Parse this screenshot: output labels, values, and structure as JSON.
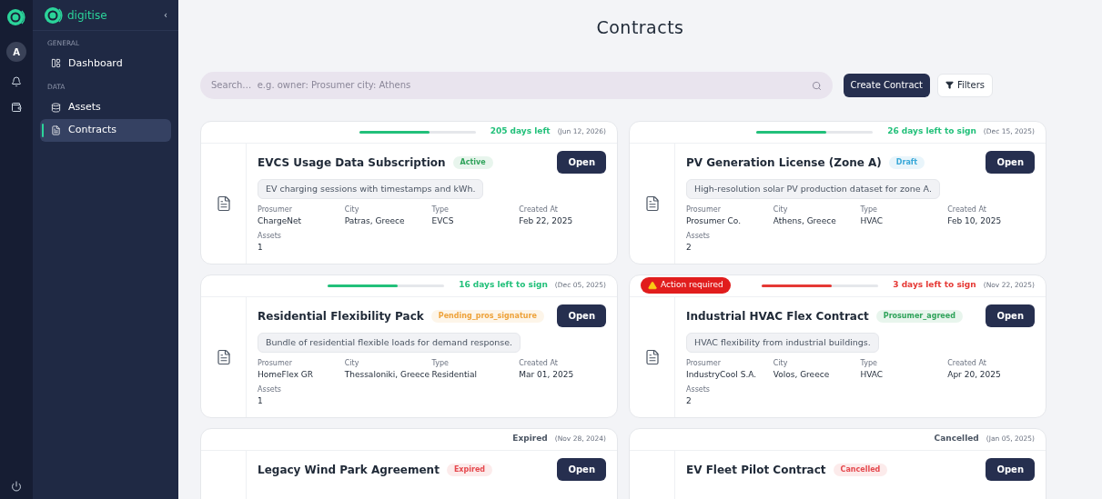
{
  "sidebar": {
    "brand": "digitise",
    "collapse": "‹",
    "avatar": "A",
    "sections": [
      {
        "heading": "GENERAL",
        "items": [
          {
            "label": "Dashboard",
            "selected": false
          }
        ]
      },
      {
        "heading": "DATA",
        "items": [
          {
            "label": "Assets",
            "selected": false
          },
          {
            "label": "Contracts",
            "selected": true
          }
        ]
      }
    ]
  },
  "page": {
    "title": "Contracts"
  },
  "search": {
    "placeholder": "Search…  e.g. owner: Prosumer city: Athens"
  },
  "actions": {
    "create": "Create Contract",
    "filters": "Filters"
  },
  "contracts": [
    {
      "deadline": {
        "label": "205 days left",
        "date": "(Jun 12, 2026)",
        "color": "#22c07a"
      },
      "progress": {
        "level": 0.6
      },
      "title": "EVCS Usage Data Subscription",
      "status": {
        "label": "Active",
        "color": "#2fa35a"
      },
      "description": "EV charging sessions with timestamps and kWh.",
      "fields": [
        {
          "label": "Prosumer",
          "value": "ChargeNet"
        },
        {
          "label": "City",
          "value": "Patras, Greece"
        },
        {
          "label": "Type",
          "value": "EVCS"
        },
        {
          "label": "Created At",
          "value": "Feb 22, 2025"
        },
        {
          "label": "Assets",
          "value": "1"
        }
      ],
      "open": "Open"
    },
    {
      "deadline": {
        "label": "26 days left to sign",
        "date": "(Dec 15, 2025)",
        "color": "#22c07a"
      },
      "progress": {
        "level": 0.6
      },
      "title": "PV Generation License (Zone A)",
      "status": {
        "label": "Draft",
        "color": "#38a8d8"
      },
      "description": "High-resolution solar PV production dataset for zone A.",
      "fields": [
        {
          "label": "Prosumer",
          "value": "Prosumer Co."
        },
        {
          "label": "City",
          "value": "Athens, Greece"
        },
        {
          "label": "Type",
          "value": "HVAC"
        },
        {
          "label": "Created At",
          "value": "Feb 10, 2025"
        },
        {
          "label": "Assets",
          "value": "2"
        }
      ],
      "open": "Open"
    },
    {
      "deadline": {
        "label": "16 days left to sign",
        "date": "(Dec 05, 2025)",
        "color": "#22c07a"
      },
      "progress": {
        "level": 0.6
      },
      "title": "Residential Flexibility Pack",
      "status": {
        "label": "Pending_pros_signature",
        "color": "#eea23a"
      },
      "description": "Bundle of residential flexible loads for demand response.",
      "fields": [
        {
          "label": "Prosumer",
          "value": "HomeFlex GR"
        },
        {
          "label": "City",
          "value": "Thessaloniki, Greece"
        },
        {
          "label": "Type",
          "value": "Residential"
        },
        {
          "label": "Created At",
          "value": "Mar 01, 2025"
        },
        {
          "label": "Assets",
          "value": "1"
        }
      ],
      "open": "Open"
    },
    {
      "alert": "Action required",
      "deadline": {
        "label": "3 days left to sign",
        "date": "(Nov 22, 2025)",
        "color": "#e53935"
      },
      "progress": {
        "level": 0.6
      },
      "title": "Industrial HVAC Flex Contract",
      "status": {
        "label": "Prosumer_agreed",
        "color": "#2fa35a"
      },
      "description": "HVAC flexibility from industrial buildings.",
      "fields": [
        {
          "label": "Prosumer",
          "value": "IndustryCool S.A."
        },
        {
          "label": "City",
          "value": "Volos, Greece"
        },
        {
          "label": "Type",
          "value": "HVAC"
        },
        {
          "label": "Created At",
          "value": "Apr 20, 2025"
        },
        {
          "label": "Assets",
          "value": "2"
        }
      ],
      "open": "Open"
    },
    {
      "deadline": {
        "label": "Expired",
        "date": "(Nov 28, 2024)",
        "color": "#4b5563"
      },
      "title": "Legacy Wind Park Agreement",
      "status": {
        "label": "Expired",
        "color": "#e5484d"
      },
      "open": "Open"
    },
    {
      "deadline": {
        "label": "Cancelled",
        "date": "(Jan 05, 2025)",
        "color": "#4b5563"
      },
      "title": "EV Fleet Pilot Contract",
      "status": {
        "label": "Cancelled",
        "color": "#e5484d"
      },
      "open": "Open"
    }
  ]
}
